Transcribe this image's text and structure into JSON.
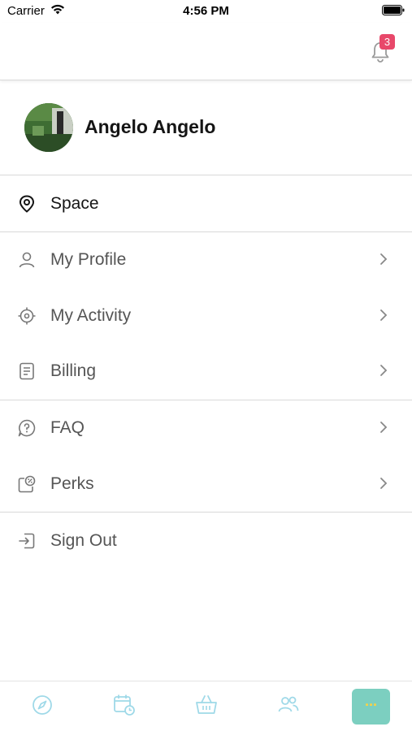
{
  "status_bar": {
    "carrier": "Carrier",
    "time": "4:56 PM"
  },
  "header": {
    "notification_count": "3"
  },
  "profile": {
    "name": "Angelo Angelo"
  },
  "menu": {
    "space": "Space",
    "my_profile": "My Profile",
    "my_activity": "My Activity",
    "billing": "Billing",
    "faq": "FAQ",
    "perks": "Perks",
    "sign_out": "Sign Out"
  },
  "tab_bar": {
    "tabs": [
      "compass-icon",
      "calendar-clock-icon",
      "basket-icon",
      "people-icon",
      "more-icon"
    ],
    "more_label": "···"
  },
  "colors": {
    "badge": "#e8486a",
    "accent_teal": "#7ccfc0",
    "tab_icon": "#9fd9e8",
    "more_dots": "#ffd23f"
  }
}
